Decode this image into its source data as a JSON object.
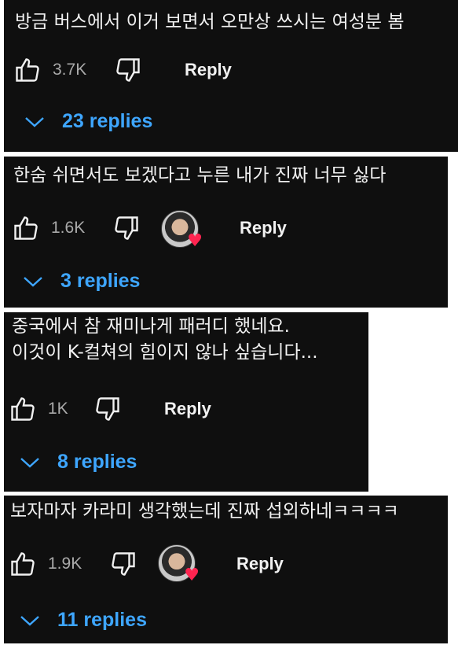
{
  "comments": [
    {
      "text_lines": [
        "방금 버스에서 이거 보면서 오만상 쓰시는 여성분 봄"
      ],
      "likes": "3.7K",
      "reply_label": "Reply",
      "replies_label": "23 replies",
      "has_creator_heart": false
    },
    {
      "text_lines": [
        "한숨 쉬면서도 보겠다고 누른 내가 진짜 너무 싫다"
      ],
      "likes": "1.6K",
      "reply_label": "Reply",
      "replies_label": "3 replies",
      "has_creator_heart": true
    },
    {
      "text_lines": [
        "중국에서 참 재미나게 패러디 했네요.",
        "이것이 K-컬쳐의 힘이지 않나 싶습니다..."
      ],
      "likes": "1K",
      "reply_label": "Reply",
      "replies_label": "8 replies",
      "has_creator_heart": false
    },
    {
      "text_lines": [
        "보자마자 카라미 생각했는데 진짜 섭외하네ㅋㅋㅋㅋ"
      ],
      "likes": "1.9K",
      "reply_label": "Reply",
      "replies_label": "11 replies",
      "has_creator_heart": true
    }
  ],
  "icons": {
    "like": "thumbs-up-icon",
    "dislike": "thumbs-down-icon",
    "expand": "chevron-down-icon",
    "heart": "heart-icon"
  },
  "colors": {
    "card_bg": "#0f0f0f",
    "text": "#f1f1f1",
    "muted": "#aaaaaa",
    "link_blue": "#3ea6ff",
    "heart_red": "#ff2450"
  }
}
